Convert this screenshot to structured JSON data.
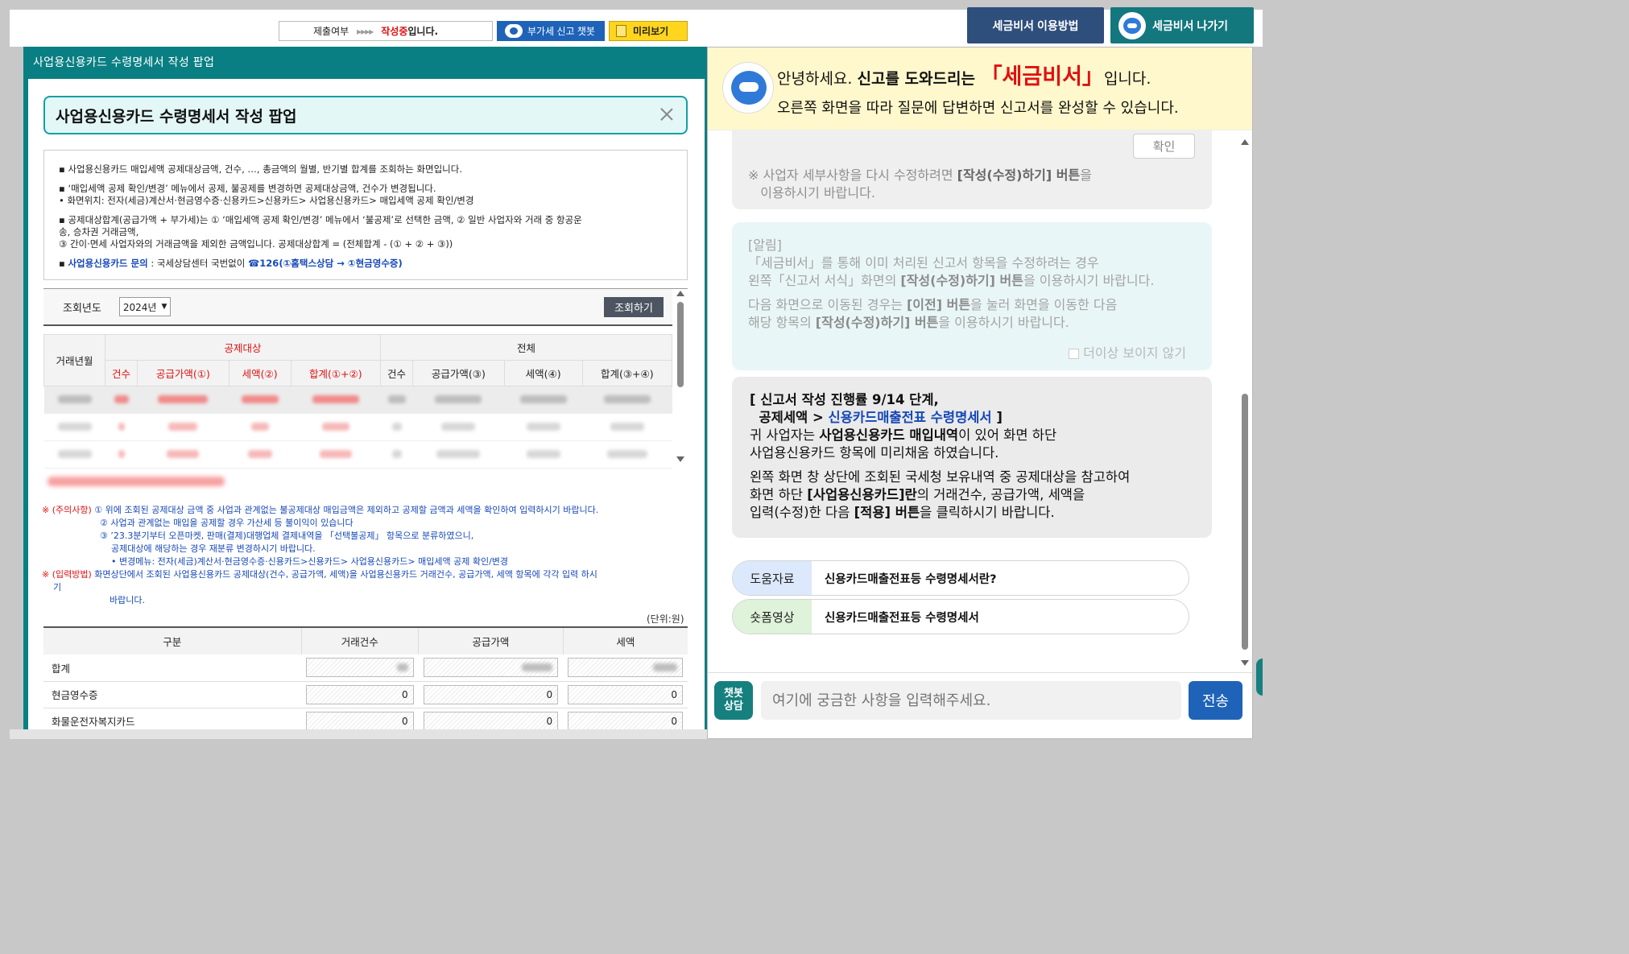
{
  "topbar": {
    "status_label": "제출여부",
    "status_arrows": "▸▸▸▸",
    "status_value": "작성중",
    "status_tail": "입니다.",
    "chatbot_btn": "부가세 신고 챗봇",
    "preview_btn": "미리보기",
    "guide_btn": "세금비서 이용방법",
    "exit_btn": "세금비서 나가기"
  },
  "popup": {
    "window_title": "사업용신용카드 수령명세서 작성 팝업",
    "inner_title": "사업용신용카드 수령명세서 작성 팝업",
    "notice": {
      "n1": "▪ 사업용신용카드 매입세액 공제대상금액, 건수, …, 총금액의 월별, 반기별 합계를 조회하는 화면입니다.",
      "n2a": "▪ ‘매입세액 공제 확인/변경’ 메뉴에서 공제, 불공제를 변경하면 공제대상금액, 건수가 변경됩니다.",
      "n2b": "  • 화면위치: 전자(세금)계산서·현금영수증·신용카드>신용카드> 사업용신용카드> 매입세액 공제 확인/변경",
      "n3a": "▪ 공제대상합계(공급가액 + 부가세)는 ① ‘매입세액 공제 확인/변경’ 메뉴에서 ‘불공제’로 선택한 금액, ② 일반 사업자와 거래 중 항공운",
      "n3b": "  송, 승차권 거래금액,",
      "n3c": "  ③ 간이·면세 사업자와의 거래금액을 제외한 금액입니다. 공제대상합계 = (전체합계 - (① + ② + ③))",
      "n4_link": "사업용신용카드 문의",
      "n4_rest": " : 국세상담센터 국번없이 ",
      "n4_phone": "☎126(①홈택스상담 → ①현금영수증)"
    },
    "query": {
      "label": "조회년도",
      "year": "2024년",
      "button": "조회하기"
    },
    "table1": {
      "row_header": "거래년월",
      "group1": "공제대상",
      "group2": "전체",
      "cols1": [
        "건수",
        "공급가액(①)",
        "세액(②)",
        "합계(①+②)"
      ],
      "cols2": [
        "건수",
        "공급가액(③)",
        "세액(④)",
        "합계(③+④)"
      ]
    },
    "caution": {
      "mark1": "※",
      "label1": "(주의사항)",
      "c1": " ① 위에 조회된 공제대상 금액 중 사업과 관계없는 불공제대상 매입금액은 제외하고 공제할 금액과 세액을 확인하여 입력하시기 바랍니다.",
      "c2": "② 사업과 관계없는 매입을 공제할 경우 가산세 등 불이익이 있습니다",
      "c3": "③ ’23.3분기부터 오픈마켓, 판매(결제)대행업체 결제내역을 「선택불공제」 항목으로 분류하였으니,",
      "c4": "공제대상에 해당하는 경우 재분류 변경하시기 바랍니다.",
      "c5": "• 변경메뉴: 전자(세금)계산서·현금영수증·신용카드>신용카드> 사업용신용카드> 매입세액 공제 확인/변경",
      "mark2": "※",
      "label2": "(입력방법)",
      "c6": " 화면상단에서 조회된 사업용신용카드 공제대상(건수, 공급가액, 세액)을 사업용신용카드 거래건수, 공급가액, 세액 항목에 각각 입력 하시",
      "c6b": "기",
      "c7": "바랍니다."
    },
    "unit": "(단위:원)",
    "table2": {
      "headers": [
        "구분",
        "거래건수",
        "공급가액",
        "세액"
      ],
      "rows": [
        {
          "label": "합계",
          "count": "",
          "supply": "",
          "tax": ""
        },
        {
          "label": "현금영수증",
          "count": "0",
          "supply": "0",
          "tax": "0"
        },
        {
          "label": "화물운전자복지카드",
          "count": "0",
          "supply": "0",
          "tax": "0"
        }
      ]
    }
  },
  "chat": {
    "greet_pre": "안녕하세요. ",
    "greet_bold": "신고를 도와드리는 ",
    "greet_brand": "「세금비서」",
    "greet_post": "입니다.",
    "greet_line2": "오른쪽 화면을 따라 질문에 답변하면 신고서를 완성할 수 있습니다.",
    "confirm_btn": "확인",
    "top_note_a": "※ 사업자 세부사항을 다시 수정하려면 ",
    "top_note_b": "[작성(수정)하기] 버튼",
    "top_note_c": "을",
    "top_note_d": "   이용하시기 바랍니다.",
    "alert": {
      "title": "[알림]",
      "l1": "「세금비서」를 통해 이미 처리된 신고서 항목을 수정하려는 경우",
      "l2a": "왼쪽「신고서 서식」화면의 ",
      "l2b": "[작성(수정)하기] 버튼",
      "l2c": "을 이용하시기 바랍니다.",
      "l3a": "다음 화면으로 이동된 경우는 ",
      "l3b": "[이전] 버튼",
      "l3c": "을 눌러 화면을 이동한 다음",
      "l4a": "해당 항목의 ",
      "l4b": "[작성(수정)하기] 버튼",
      "l4c": "을 이용하시기 바랍니다.",
      "nomore": "더이상 보이지 않기"
    },
    "main": {
      "h1": "[ 신고서 작성 진행률 9/14 단계,",
      "h2a": "  공제세액 > ",
      "h2b": "신용카드매출전표 수령명세서",
      "h2c": " ]",
      "p1a": "귀 사업자는 ",
      "p1b": "사업용신용카드 매입내역",
      "p1c": "이 있어 화면 하단",
      "p2": "사업용신용카드 항목에 미리채움 하였습니다.",
      "p3": "왼쪽 화면 창 상단에 조회된 국세청 보유내역 중 공제대상을 참고하여",
      "p4a": "화면 하단 ",
      "p4b": "[사업용신용카드]란",
      "p4c": "의 거래건수, 공급가액, 세액을",
      "p5a": "입력(수정)한 다음 ",
      "p5b": "[적용] 버튼",
      "p5c": "을 클릭하시기 바랍니다."
    },
    "ref1_tag": "도움자료",
    "ref1_val": "신용카드매출전표등 수령명세서란?",
    "ref2_tag": "숏폼영상",
    "ref2_val": "신용카드매출전표등 수령명세서",
    "badge": "챗봇\n상담",
    "input_placeholder": "여기에 궁금한 사항을 입력해주세요.",
    "send_btn": "전송"
  },
  "colors": {
    "teal": "#0a7f83",
    "navy": "#2e4e7c",
    "blue": "#1e63b8",
    "red": "#e01010",
    "yellow": "#ffd51d"
  }
}
